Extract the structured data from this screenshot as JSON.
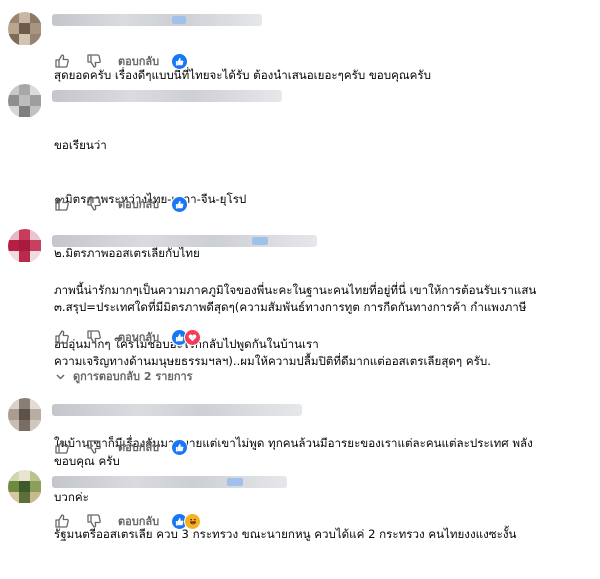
{
  "actions": {
    "reply_label": "ตอบกลับ"
  },
  "colors": {
    "like": "#1877f2",
    "love": "#f33e58",
    "haha": "#f7b125",
    "muted": "#65676b"
  },
  "comments": [
    {
      "lines": [
        "สุดยอดครับ เรื่องดีๆแบบนี้ที่ไทยจะได้รับ ต้องนำเสนอเยอะๆครับ ขอบคุณครับ"
      ],
      "reactions": [
        "like"
      ]
    },
    {
      "lines": [
        "ขอเรียนว่า",
        "๑.มิตรภาพระหว่างไทย-เมกา-จีน-ยุโรป",
        "๒.มิตรภาพออสเตรเลียกับไทย",
        "๓.สรุป=ประเทศใดที่มีมิตรภาพดีสุดๆ(ความสัมพันธ์ทางการทูต การกีดกันทางการค้า กำแพงภาษี",
        "ความเจริญทางด้านมนุษยธรรมฯลฯ)..ผมให้ความปลื้มปิติที่ดีมากแต่ออสเตรเลียสุดๆ ครับ."
      ],
      "reactions": [
        "like"
      ]
    },
    {
      "lines": [
        "ภาพนี้น่ารักมากๆเป็นความภาคภูมิใจของพี่นะคะในฐานะคนไทยที่อยู่ที่นี่ เขาให้การต้อนรับเราแสน",
        "อบอุ่นมากๆ ใครไม่ชอบอะไรก็กลับไปพูดกันในบ้านเรา",
        "",
        "ในบ้านเขาก็มีเรื่องกันมากมายแต่เขาไม่พูด ทุกคนล้วนมีอารยะของเราแต่ละคนแต่ละประเทศ พลัง",
        "บวกค่ะ"
      ],
      "reactions": [
        "like",
        "love"
      ]
    },
    {
      "lines": [
        "ขอบคุณ ครับ"
      ],
      "reactions": [
        "like"
      ]
    },
    {
      "lines": [
        "รัฐมนตรีออสเตรเลีย ควบ 3 กระทรวง ขณะนายกหนู ควบได้แค่ 2 กระทรวง คนไทยงงแงซะงั้น"
      ],
      "reactions": [
        "like",
        "haha"
      ]
    }
  ],
  "view_replies": {
    "label": "ดูการตอบกลับ 2 รายการ"
  }
}
